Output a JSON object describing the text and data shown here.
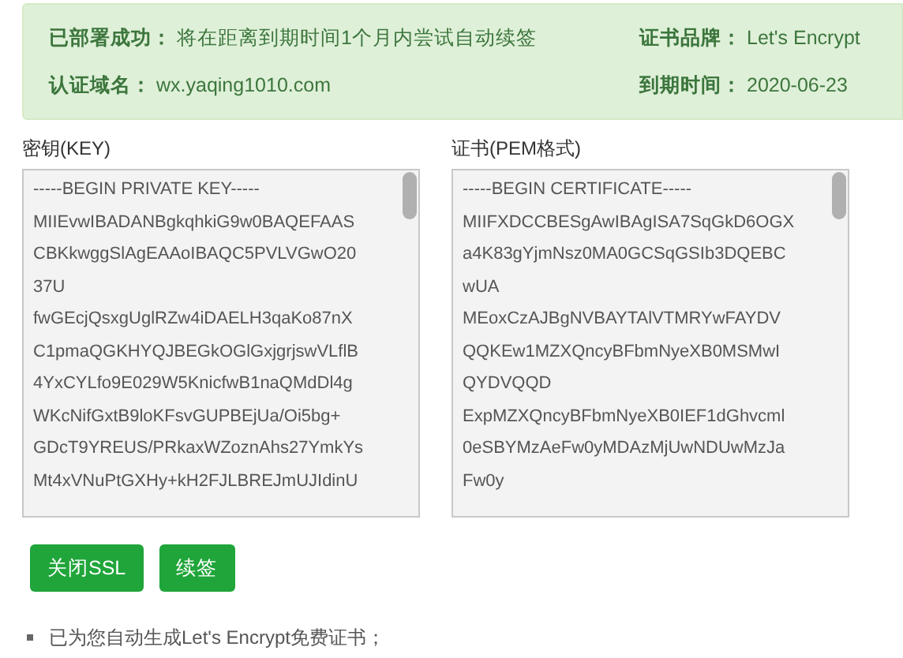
{
  "status_banner": {
    "fields": [
      {
        "label": "已部署成功：",
        "value": "将在距离到期时间1个月内尝试自动续签"
      },
      {
        "label": "证书品牌：",
        "value": "Let's Encrypt"
      },
      {
        "label": "认证域名：",
        "value": "wx.yaqing1010.com"
      },
      {
        "label": "到期时间：",
        "value": "2020-06-23"
      }
    ]
  },
  "panels": [
    {
      "label": "密钥(KEY)",
      "lines": [
        "-----BEGIN PRIVATE KEY-----",
        "MIIEvwIBADANBgkqhkiG9w0BAQEFAAS",
        "CBKkwggSlAgEAAoIBAQC5PVLVGwO20",
        "37U",
        "fwGEcjQsxgUglRZw4iDAELH3qaKo87nX",
        "C1pmaQGKHYQJBEGkOGlGxjgrjswVLflB",
        "4YxCYLfo9E029W5KnicfwB1naQMdDl4g",
        "WKcNifGxtB9loKFsvGUPBEjUa/Oi5bg+",
        "GDcT9YREUS/PRkaxWZoznAhs27YmkYs",
        "Mt4xVNuPtGXHy+kH2FJLBREJmUJIdinU"
      ]
    },
    {
      "label": "证书(PEM格式)",
      "lines": [
        "-----BEGIN CERTIFICATE-----",
        "MIIFXDCCBESgAwIBAgISA7SqGkD6OGX",
        "a4K83gYjmNsz0MA0GCSqGSIb3DQEBC",
        "wUA",
        "MEoxCzAJBgNVBAYTAlVTMRYwFAYDV",
        "QQKEw1MZXQncyBFbmNyeXB0MSMwI",
        "QYDVQQD",
        "ExpMZXQncyBFbmNyeXB0IEF1dGhvcml",
        "0eSBYMzAeFw0yMDAzMjUwNDUwMzJa",
        "Fw0y"
      ]
    }
  ],
  "buttons": [
    "关闭SSL",
    "续签"
  ],
  "notes": [
    "已为您自动生成Let's Encrypt免费证书；"
  ]
}
